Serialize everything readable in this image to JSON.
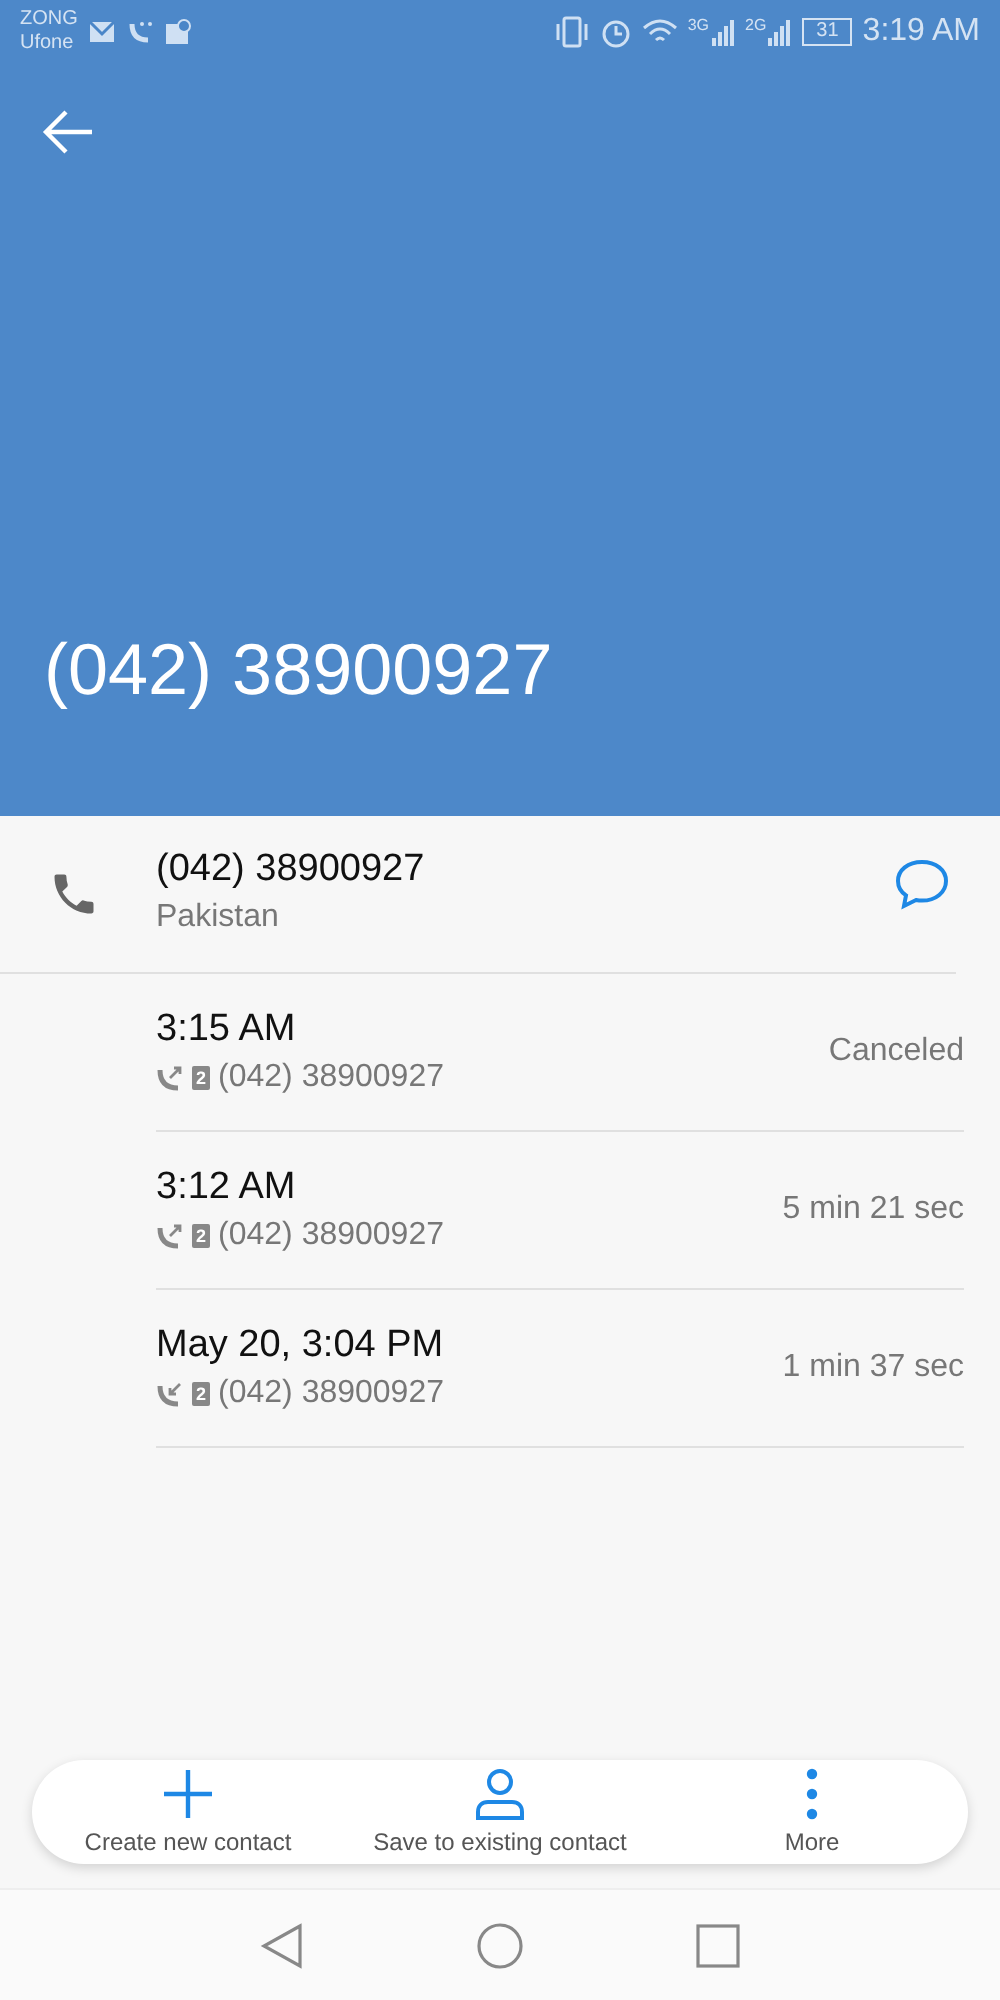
{
  "status_bar": {
    "carriers": [
      "ZONG",
      "Ufone"
    ],
    "network_1": "3G",
    "network_2": "2G",
    "battery": "31",
    "time": "3:19 AM"
  },
  "header": {
    "title": "(042) 38900927"
  },
  "contact": {
    "number": "(042) 38900927",
    "location": "Pakistan"
  },
  "calls": [
    {
      "time": "3:15 AM",
      "kind": "outgoing",
      "sim": "2",
      "number": "(042) 38900927",
      "result": "Canceled"
    },
    {
      "time": "3:12 AM",
      "kind": "outgoing",
      "sim": "2",
      "number": "(042) 38900927",
      "result": "5 min 21 sec"
    },
    {
      "time": "May 20, 3:04 PM",
      "kind": "incoming",
      "sim": "2",
      "number": "(042) 38900927",
      "result": "1 min 37 sec"
    }
  ],
  "actions": [
    {
      "label": "Create new contact",
      "kind": "add"
    },
    {
      "label": "Save to existing contact",
      "kind": "person"
    },
    {
      "label": "More",
      "kind": "more"
    }
  ]
}
